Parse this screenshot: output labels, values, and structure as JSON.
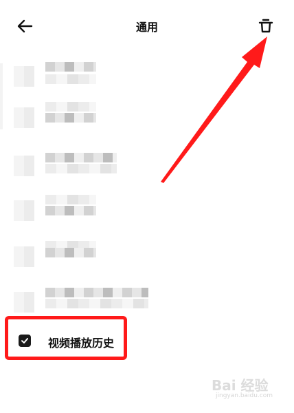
{
  "header": {
    "title": "通用",
    "back_icon": "arrow-left-icon",
    "delete_icon": "trash-icon"
  },
  "list": {
    "items": [
      {
        "label": "",
        "obscured": true
      },
      {
        "label": "",
        "obscured": true
      },
      {
        "label": "",
        "obscured": true
      },
      {
        "label": "",
        "obscured": true
      },
      {
        "label": "",
        "obscured": true
      },
      {
        "label": "",
        "obscured": true
      }
    ]
  },
  "history_item": {
    "label": "视频播放历史",
    "checked": true
  },
  "watermark": {
    "main": "Bai 经验",
    "sub": "jingyan.baidu.com"
  },
  "colors": {
    "annotation_red": "#ff1a1a",
    "checkbox_fill": "#1a1a1a"
  }
}
